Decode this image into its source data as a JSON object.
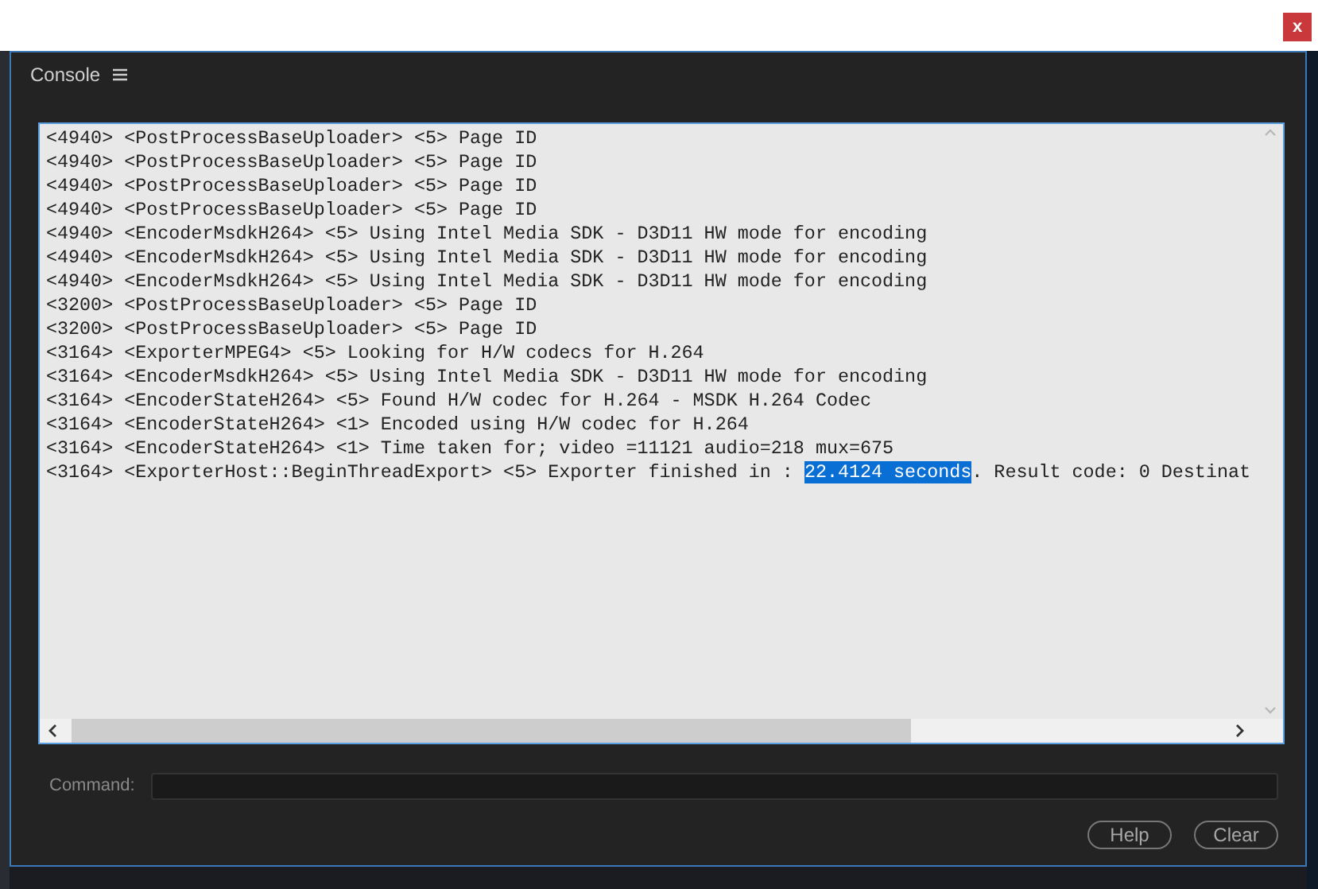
{
  "window": {
    "close": "x"
  },
  "panel": {
    "title": "Console"
  },
  "log": [
    {
      "segments": [
        {
          "text": "<4940> <PostProcessBaseUploader> <5> Page ID",
          "selected": false
        }
      ]
    },
    {
      "segments": [
        {
          "text": "<4940> <PostProcessBaseUploader> <5> Page ID",
          "selected": false
        }
      ]
    },
    {
      "segments": [
        {
          "text": "<4940> <PostProcessBaseUploader> <5> Page ID",
          "selected": false
        }
      ]
    },
    {
      "segments": [
        {
          "text": "<4940> <PostProcessBaseUploader> <5> Page ID",
          "selected": false
        }
      ]
    },
    {
      "segments": [
        {
          "text": "<4940> <EncoderMsdkH264> <5> Using Intel Media SDK - D3D11 HW mode for encoding",
          "selected": false
        }
      ]
    },
    {
      "segments": [
        {
          "text": "<4940> <EncoderMsdkH264> <5> Using Intel Media SDK - D3D11 HW mode for encoding",
          "selected": false
        }
      ]
    },
    {
      "segments": [
        {
          "text": "<4940> <EncoderMsdkH264> <5> Using Intel Media SDK - D3D11 HW mode for encoding",
          "selected": false
        }
      ]
    },
    {
      "segments": [
        {
          "text": "<3200> <PostProcessBaseUploader> <5> Page ID",
          "selected": false
        }
      ]
    },
    {
      "segments": [
        {
          "text": "<3200> <PostProcessBaseUploader> <5> Page ID",
          "selected": false
        }
      ]
    },
    {
      "segments": [
        {
          "text": "<3164> <ExporterMPEG4> <5> Looking for H/W codecs for H.264",
          "selected": false
        }
      ]
    },
    {
      "segments": [
        {
          "text": "<3164> <EncoderMsdkH264> <5> Using Intel Media SDK - D3D11 HW mode for encoding",
          "selected": false
        }
      ]
    },
    {
      "segments": [
        {
          "text": "<3164> <EncoderStateH264> <5> Found H/W codec for H.264 - MSDK H.264 Codec",
          "selected": false
        }
      ]
    },
    {
      "segments": [
        {
          "text": "<3164> <EncoderStateH264> <1> Encoded using H/W codec for H.264",
          "selected": false
        }
      ]
    },
    {
      "segments": [
        {
          "text": "<3164> <EncoderStateH264> <1> Time taken for; video =11121 audio=218 mux=675",
          "selected": false
        }
      ]
    },
    {
      "segments": [
        {
          "text": "<3164> <ExporterHost::BeginThreadExport> <5> Exporter finished in : ",
          "selected": false
        },
        {
          "text": "22.4124 seconds",
          "selected": true
        },
        {
          "text": ". Result code: 0 Destinat",
          "selected": false
        }
      ]
    }
  ],
  "command": {
    "label": "Command:"
  },
  "buttons": [
    "Help",
    "Clear"
  ]
}
